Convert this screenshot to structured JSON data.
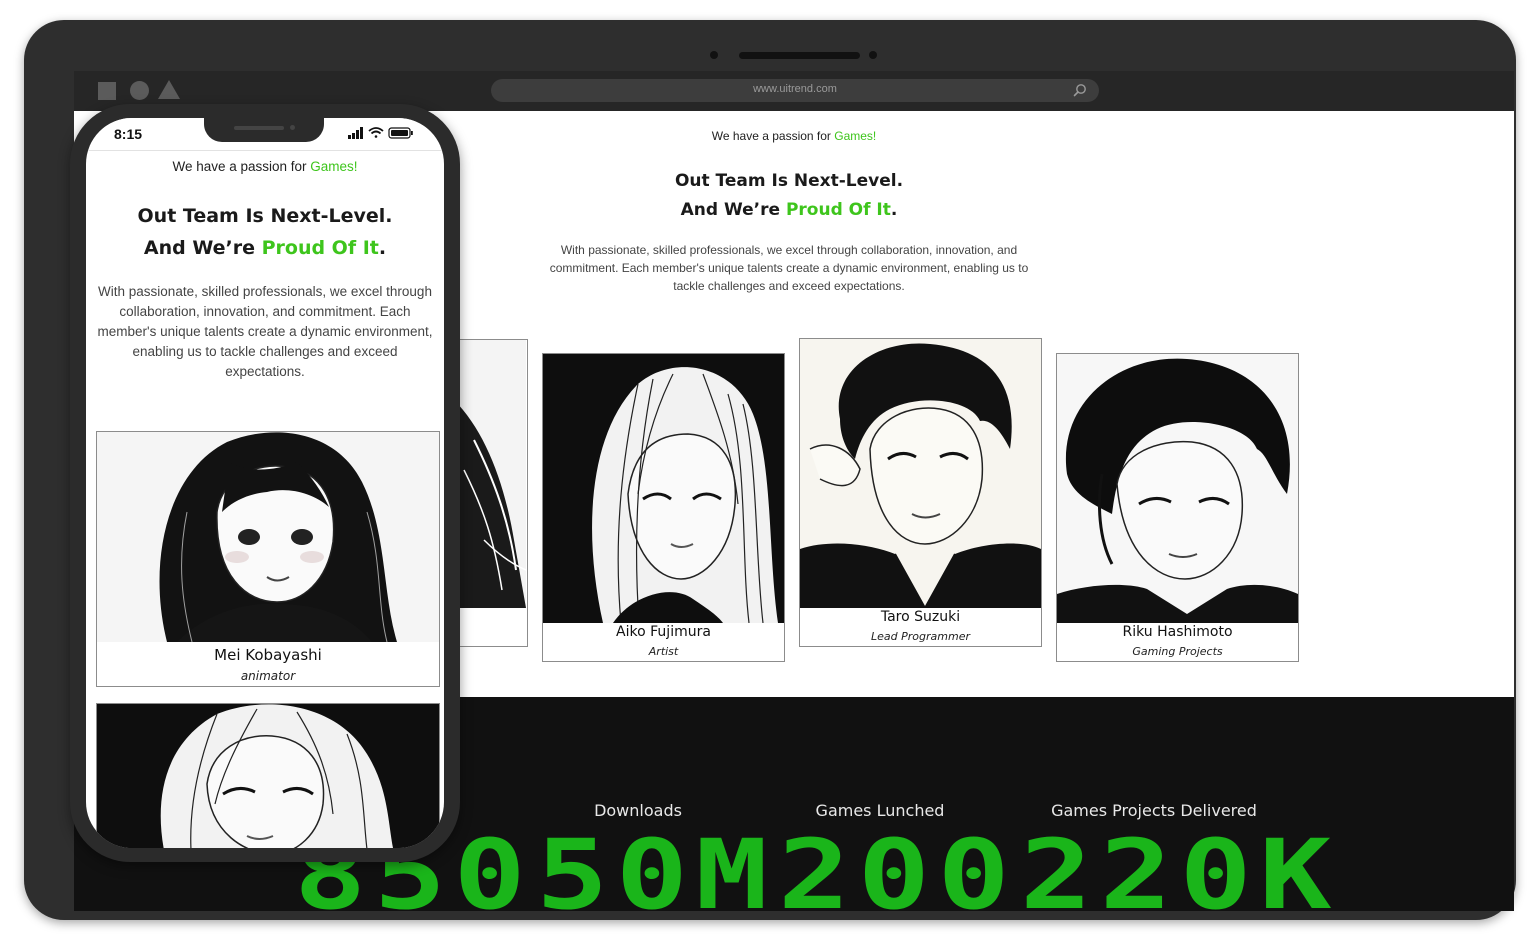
{
  "browser": {
    "url": "www.uitrend.com"
  },
  "desktop": {
    "tagline_prefix": "We have a passion for ",
    "tagline_highlight": "Games!",
    "headline_line1": "Out Team Is Next-Level.",
    "headline_line2_prefix": "And We’re ",
    "headline_line2_highlight": "Proud Of It",
    "headline_line2_suffix": ".",
    "description": "With passionate, skilled professionals, we excel through collaboration, innovation, and commitment. Each member's unique talents create a dynamic environment, enabling us to tackle challenges and exceed expectations.",
    "team": [
      {
        "name": "Aiko Fujimura",
        "role": "Artist"
      },
      {
        "name": "Taro Suzuki",
        "role": "Lead Programmer"
      },
      {
        "name": "Riku Hashimoto",
        "role": "Gaming Projects"
      }
    ],
    "stats": [
      {
        "label": "Downloads",
        "value": "50M"
      },
      {
        "label": "Games Lunched",
        "value": "200"
      },
      {
        "label": "Games Projects Delivered",
        "value": "220K"
      }
    ],
    "partial_stat_value": "850"
  },
  "mobile": {
    "time": "8:15",
    "tagline_prefix": "We have a passion for ",
    "tagline_highlight": "Games!",
    "headline_line1": "Out Team Is Next-Level.",
    "headline_line2_prefix": "And We’re ",
    "headline_line2_highlight": "Proud Of It",
    "headline_line2_suffix": ".",
    "description": "With passionate, skilled professionals, we excel through collaboration, innovation, and commitment. Each member's unique talents create a dynamic environment, enabling us to tackle challenges and exceed expectations.",
    "team": [
      {
        "name": "Mei Kobayashi",
        "role": "animator"
      }
    ]
  },
  "colors": {
    "accent": "#3ec51c",
    "counter": "#1ab51a",
    "frame": "#2e2e2e",
    "stats_bg": "#111111"
  },
  "icons": [
    "search-icon",
    "signal-icon",
    "wifi-icon",
    "battery-icon"
  ]
}
